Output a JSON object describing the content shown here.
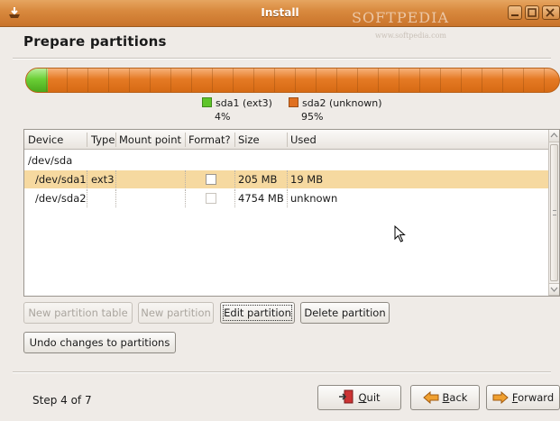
{
  "window": {
    "title": "Install",
    "watermark": "SOFTPEDIA",
    "watermark_url": "www.softpedia.com",
    "title_icon": "installer-icon",
    "controls": [
      "minimize-icon",
      "maximize-icon",
      "close-icon"
    ]
  },
  "heading": "Prepare partitions",
  "partition_bar": {
    "segments": [
      {
        "name": "sda1 (ext3)",
        "percent_label": "4%",
        "fraction": 0.04,
        "color": "#5fc52a"
      },
      {
        "name": "sda2 (unknown)",
        "percent_label": "95%",
        "fraction": 0.95,
        "color": "#e07020"
      }
    ]
  },
  "table": {
    "columns": [
      "Device",
      "Type",
      "Mount point",
      "Format?",
      "Size",
      "Used"
    ],
    "rows": [
      {
        "device": "/dev/sda",
        "type": "",
        "mount": "",
        "format": null,
        "size": "",
        "used": "",
        "selected": false
      },
      {
        "device": "/dev/sda1",
        "type": "ext3",
        "mount": "",
        "format": false,
        "size": "205 MB",
        "used": "19 MB",
        "selected": true
      },
      {
        "device": "/dev/sda2",
        "type": "",
        "mount": "",
        "format": false,
        "size": "4754 MB",
        "used": "unknown",
        "selected": false
      }
    ]
  },
  "buttons": {
    "new_partition_table": "New partition table",
    "new_partition": "New partition",
    "edit_partition": "Edit partition",
    "delete_partition": "Delete partition",
    "undo_changes": "Undo changes to partitions"
  },
  "footer": {
    "step": "Step 4 of 7",
    "quit_q": "Q",
    "quit_rest": "uit",
    "back_b": "B",
    "back_rest": "ack",
    "forward_f": "F",
    "forward_rest": "orward"
  },
  "colors": {
    "titlebar": "#d98a3f",
    "selected_row": "#f6d9a0",
    "sda1": "#5fc52a",
    "sda2": "#e07020"
  }
}
